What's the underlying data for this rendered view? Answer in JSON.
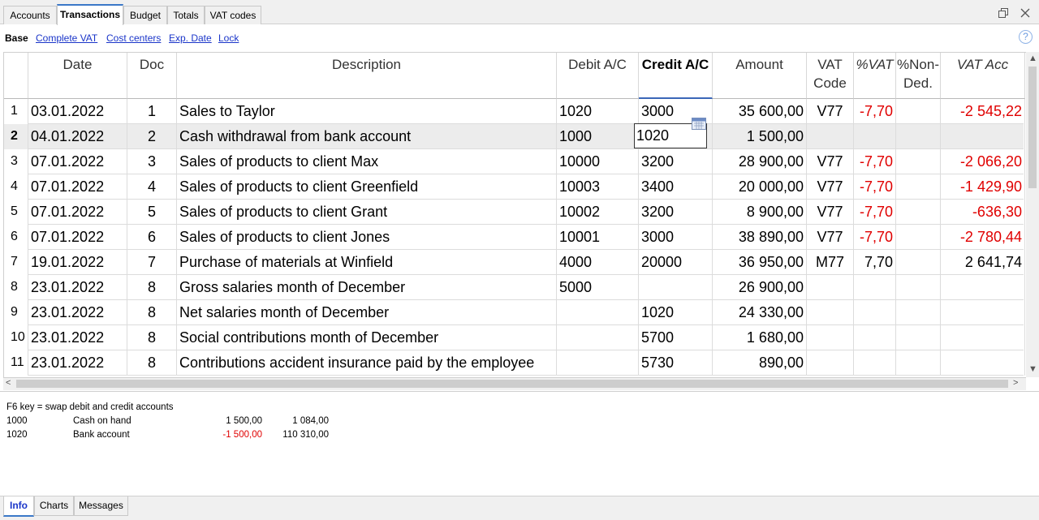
{
  "tabs": [
    "Accounts",
    "Transactions",
    "Budget",
    "Totals",
    "VAT codes"
  ],
  "active_tab": "Transactions",
  "views": [
    "Base",
    "Complete VAT",
    "Cost centers",
    "Exp. Date",
    "Lock"
  ],
  "active_view": "Base",
  "help_symbol": "?",
  "columns": {
    "date": "Date",
    "doc": "Doc",
    "description": "Description",
    "debit": "Debit A/C",
    "credit": "Credit A/C",
    "amount": "Amount",
    "vat_code_1": "VAT",
    "vat_code_2": "Code",
    "pct_vat": "%VAT",
    "non_ded_1": "%Non-",
    "non_ded_2": "Ded.",
    "vat_acc": "VAT Acc"
  },
  "rows": [
    {
      "n": "1",
      "date": "03.01.2022",
      "doc": "1",
      "desc": "Sales to Taylor",
      "debit": "1020",
      "credit": "3000",
      "amount": "35 600,00",
      "vat": "V77",
      "pct": "-7,70",
      "nonded": "",
      "vatacc": "-2 545,22"
    },
    {
      "n": "2",
      "date": "04.01.2022",
      "doc": "2",
      "desc": "Cash withdrawal from bank account",
      "debit": "1000",
      "credit": "1020",
      "amount": "1 500,00",
      "vat": "",
      "pct": "",
      "nonded": "",
      "vatacc": ""
    },
    {
      "n": "3",
      "date": "07.01.2022",
      "doc": "3",
      "desc": "Sales of products to client Max",
      "debit": "10000",
      "credit": "3200",
      "amount": "28 900,00",
      "vat": "V77",
      "pct": "-7,70",
      "nonded": "",
      "vatacc": "-2 066,20"
    },
    {
      "n": "4",
      "date": "07.01.2022",
      "doc": "4",
      "desc": "Sales of products to client Greenfield",
      "debit": "10003",
      "credit": "3400",
      "amount": "20 000,00",
      "vat": "V77",
      "pct": "-7,70",
      "nonded": "",
      "vatacc": "-1 429,90"
    },
    {
      "n": "5",
      "date": "07.01.2022",
      "doc": "5",
      "desc": "Sales of products to client Grant",
      "debit": "10002",
      "credit": "3200",
      "amount": "8 900,00",
      "vat": "V77",
      "pct": "-7,70",
      "nonded": "",
      "vatacc": "-636,30"
    },
    {
      "n": "6",
      "date": "07.01.2022",
      "doc": "6",
      "desc": "Sales of products to client Jones",
      "debit": "10001",
      "credit": "3000",
      "amount": "38 890,00",
      "vat": "V77",
      "pct": "-7,70",
      "nonded": "",
      "vatacc": "-2 780,44"
    },
    {
      "n": "7",
      "date": "19.01.2022",
      "doc": "7",
      "desc": "Purchase of materials at Winfield",
      "debit": "4000",
      "credit": "20000",
      "amount": "36 950,00",
      "vat": "M77",
      "pct": "7,70",
      "nonded": "",
      "vatacc": "2 641,74"
    },
    {
      "n": "8",
      "date": "23.01.2022",
      "doc": "8",
      "desc": "Gross salaries month of December",
      "debit": "5000",
      "credit": "",
      "amount": "26 900,00",
      "vat": "",
      "pct": "",
      "nonded": "",
      "vatacc": ""
    },
    {
      "n": "9",
      "date": "23.01.2022",
      "doc": "8",
      "desc": "Net salaries month of December",
      "debit": "",
      "credit": "1020",
      "amount": "24 330,00",
      "vat": "",
      "pct": "",
      "nonded": "",
      "vatacc": ""
    },
    {
      "n": "10",
      "date": "23.01.2022",
      "doc": "8",
      "desc": "Social contributions month of December",
      "debit": "",
      "credit": "5700",
      "amount": "1 680,00",
      "vat": "",
      "pct": "",
      "nonded": "",
      "vatacc": ""
    },
    {
      "n": "11",
      "date": "23.01.2022",
      "doc": "8",
      "desc": "Contributions accident insurance paid by the employee",
      "debit": "",
      "credit": "5730",
      "amount": "890,00",
      "vat": "",
      "pct": "",
      "nonded": "",
      "vatacc": ""
    }
  ],
  "info": {
    "hint": "F6 key = swap debit and credit accounts",
    "lines": [
      {
        "account": "1000",
        "name": "Cash on hand",
        "amount": "1 500,00",
        "balance": "1 084,00",
        "negative": false
      },
      {
        "account": "1020",
        "name": "Bank account",
        "amount": "-1 500,00",
        "balance": "110 310,00",
        "negative": true
      }
    ]
  },
  "bottom_tabs": [
    "Info",
    "Charts",
    "Messages"
  ],
  "active_bottom_tab": "Info",
  "colors": {
    "accent": "#3b78c8",
    "negative": "#e00000",
    "link": "#1a35c9"
  }
}
